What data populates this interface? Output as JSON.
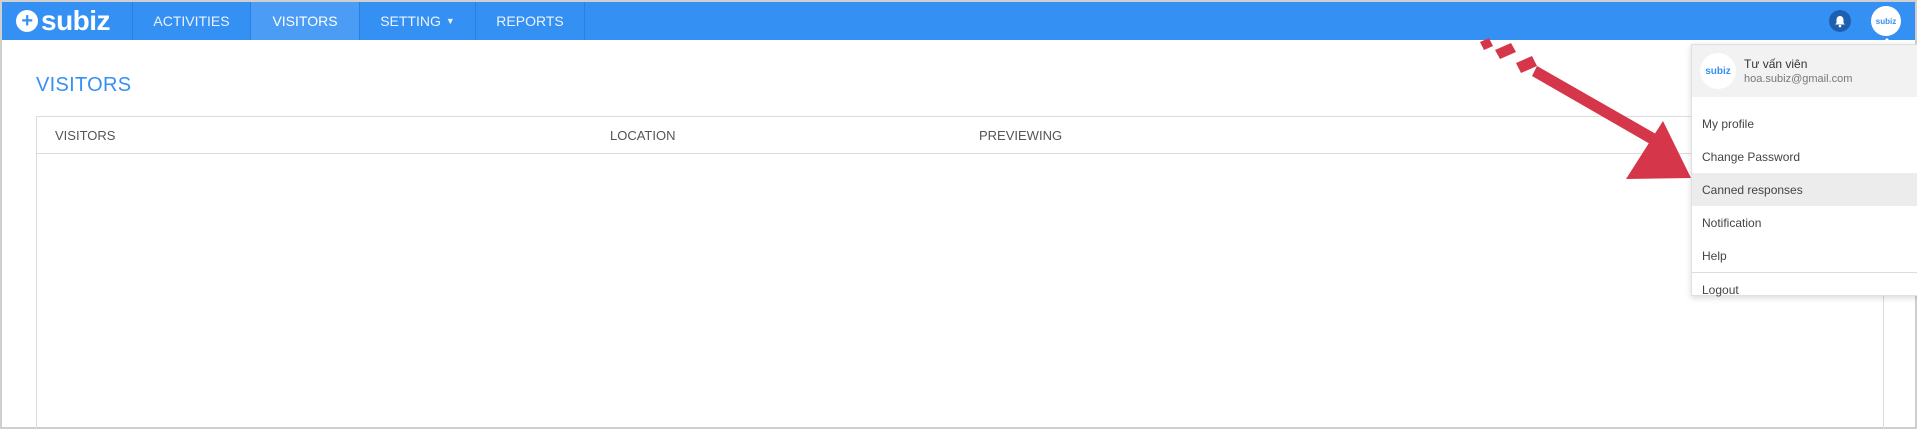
{
  "app": {
    "logo_text": "subiz",
    "logo_plus": "+"
  },
  "nav": {
    "items": [
      {
        "label": "ACTIVITIES"
      },
      {
        "label": "VISITORS"
      },
      {
        "label": "SETTING"
      },
      {
        "label": "REPORTS"
      }
    ],
    "active": "VISITORS",
    "avatar_text": "subiz"
  },
  "page": {
    "title": "VISITORS"
  },
  "table": {
    "columns": [
      "VISITORS",
      "LOCATION",
      "PREVIEWING"
    ]
  },
  "dropdown": {
    "avatar_text": "subiz",
    "user_name": "Tư vấn viên",
    "user_email": "hoa.subiz@gmail.com",
    "items": [
      "My profile",
      "Change Password",
      "Canned responses",
      "Notification",
      "Help"
    ],
    "highlighted": "Canned responses",
    "logout": "Logout"
  },
  "colors": {
    "brand": "#3590f3",
    "arrow": "#d5364a"
  }
}
